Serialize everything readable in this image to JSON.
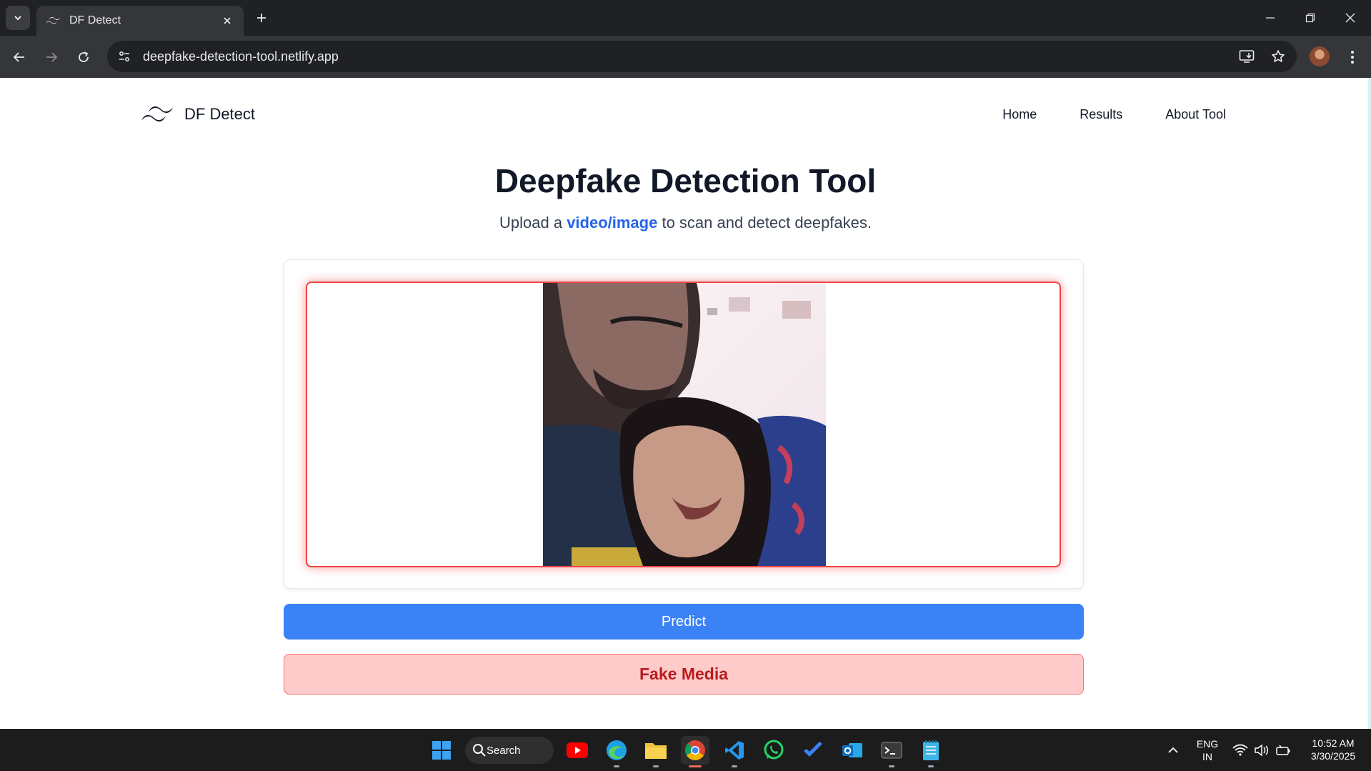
{
  "browser": {
    "tab_title": "DF Detect",
    "url": "deepfake-detection-tool.netlify.app"
  },
  "nav": {
    "brand": "DF Detect",
    "links": [
      "Home",
      "Results",
      "About Tool"
    ]
  },
  "hero": {
    "title": "Deepfake Detection Tool",
    "subtitle_before": "Upload a ",
    "subtitle_highlight": "video/image",
    "subtitle_after": " to scan and detect deepfakes."
  },
  "actions": {
    "predict_label": "Predict",
    "result_label": "Fake Media"
  },
  "colors": {
    "accent_blue": "#3b82f6",
    "result_bg": "#fecaca",
    "result_text": "#b91c1c",
    "preview_border": "#ef4444"
  },
  "taskbar": {
    "search_label": "Search",
    "lang_top": "ENG",
    "lang_bottom": "IN",
    "time": "10:52 AM",
    "date": "3/30/2025"
  }
}
